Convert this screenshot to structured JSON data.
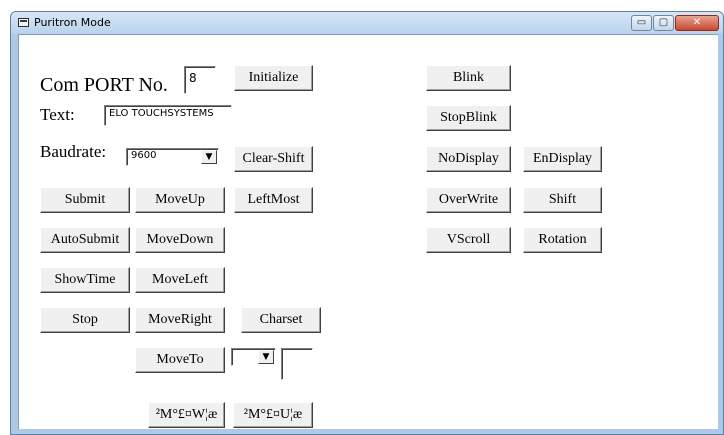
{
  "window": {
    "title": "Puritron Mode",
    "icon": "app-window-icon",
    "caption_buttons": {
      "minimize": "▭",
      "maximize": "▢",
      "close": "✕"
    }
  },
  "labels": {
    "com_port": "Com PORT No.",
    "text": "Text:",
    "baudrate": "Baudrate:"
  },
  "fields": {
    "com_port_value": "8",
    "text_value": "ELO TOUCHSYSTEMS",
    "baudrate_value": "9600",
    "moveto_combo_value": "",
    "moveto_box_value": ""
  },
  "buttons": {
    "initialize": "Initialize",
    "clear_shift": "Clear-Shift",
    "submit": "Submit",
    "moveup": "MoveUp",
    "leftmost": "LeftMost",
    "autosubmit": "AutoSubmit",
    "movedown": "MoveDown",
    "showtime": "ShowTime",
    "moveleft": "MoveLeft",
    "stop": "Stop",
    "moveright": "MoveRight",
    "charset": "Charset",
    "moveto": "MoveTo",
    "garbled1": "²M°£¤W¦æ",
    "garbled2": "²M°£¤U¦æ",
    "blink": "Blink",
    "stopblink": "StopBlink",
    "nodisplay": "NoDisplay",
    "endisplay": "EnDisplay",
    "overwrite": "OverWrite",
    "shift": "Shift",
    "vscroll": "VScroll",
    "rotation": "Rotation"
  },
  "dropdown_arrow": "▼"
}
